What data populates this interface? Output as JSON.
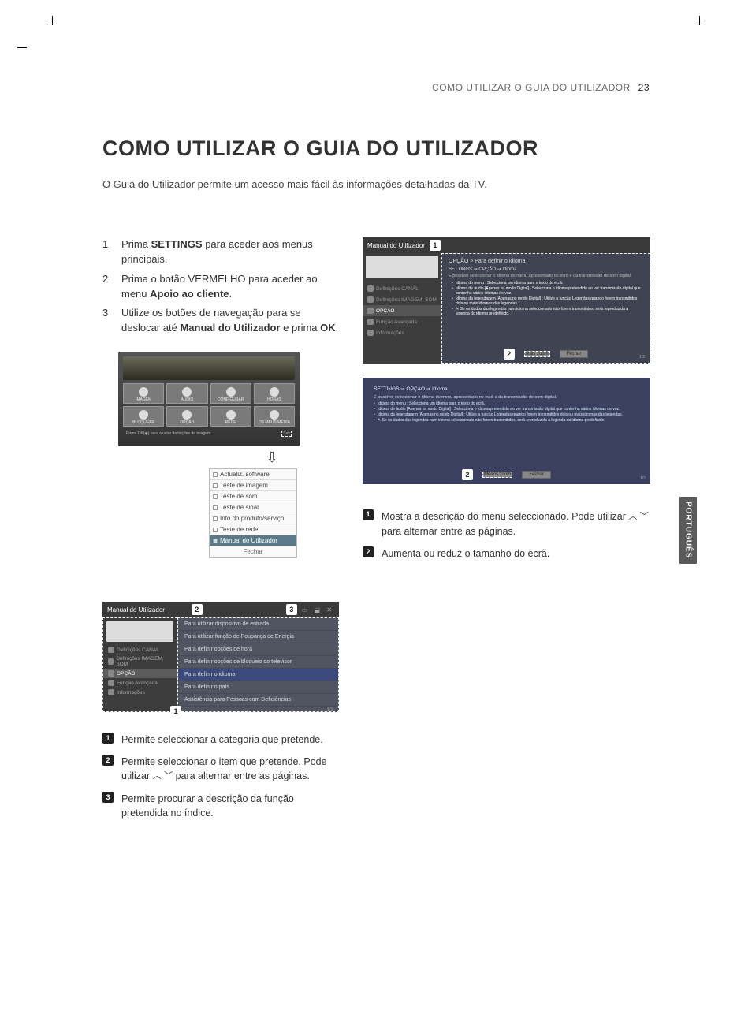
{
  "page": {
    "running_head": "COMO UTILIZAR O GUIA DO UTILIZADOR",
    "number": "23",
    "title": "COMO UTILIZAR O GUIA DO UTILIZADOR",
    "intro": "O Guia do Utilizador permite um acesso mais fácil às informações detalhadas da TV.",
    "side_tab": "PORTUGUÊS"
  },
  "steps": [
    {
      "n": "1",
      "pre": "Prima ",
      "bold": "SETTINGS",
      "post": " para aceder aos menus principais."
    },
    {
      "n": "2",
      "pre": "Prima o botão VERMELHO para aceder ao menu ",
      "bold": "Apoio ao cliente",
      "post": "."
    },
    {
      "n": "3",
      "pre": "Utilize os botões de navegação para se deslocar até ",
      "bold": "Manual do Utilizador",
      "post": " e prima ",
      "bold2": "OK",
      "post2": "."
    }
  ],
  "tv_menu": {
    "tiles": [
      "IMAGEM",
      "ÁUDIO",
      "CONFIGURAR",
      "HORAS",
      "BLOQUEAR",
      "OPÇÃO",
      "REDE",
      "OS MEUS MÉDIA"
    ],
    "footer_left": "Prima OK(◉) para ajustar definições de imagem.",
    "footer_right": "Sair"
  },
  "down_arrow": "⇩",
  "drop_list": {
    "items": [
      "Actualiz. software",
      "Teste de imagem",
      "Teste de som",
      "Teste de sinal",
      "Info do produto/serviço",
      "Teste de rede"
    ],
    "highlight": "Manual do Utilizador",
    "close": "Fechar"
  },
  "manual_wide": {
    "title": "Manual do Utilizador",
    "callout_a": "2",
    "callout_b": "3",
    "callout_c": "1",
    "side_cats": [
      "Definições CANAL",
      "Definições IMAGEM, SOM",
      "OPÇÃO",
      "Função Avançada",
      "Informações"
    ],
    "side_selected_index": 2,
    "rows": [
      "Para utilizar dispositivo de entrada",
      "Para utilizar função de Poupança de Energia",
      "Para definir opções de hora",
      "Para definir opções de bloqueio do televisor",
      "Para definir o idioma",
      "Para definir o país",
      "Assistência para Pessoas com Deficiências"
    ],
    "row_selected_index": 4,
    "footer": "1/2"
  },
  "left_callouts": [
    {
      "n": "1",
      "text": "Permite seleccionar a categoria que pretende."
    },
    {
      "n": "2",
      "text_pre": "Permite seleccionar o item que pretende. Pode utilizar ",
      "text_post": " para alternar entre as páginas."
    },
    {
      "n": "3",
      "text": "Permite procurar a descrição da função pretendida no índice."
    }
  ],
  "rs1": {
    "title": "Manual do Utilizador",
    "callout_a": "1",
    "callout_b": "2",
    "side_cats": [
      "Definições CANAL",
      "Definições IMAGEM, SOM",
      "OPÇÃO",
      "Função Avançada",
      "Informações"
    ],
    "side_selected_index": 2,
    "crumb_box": "OPÇÃO > Para definir o idioma",
    "sub": "SETTINGS ➙ OPÇÃO ➙ Idioma",
    "desc": "É possível seleccionar o idioma do menu apresentado no ecrã e da transmissão de som digital.",
    "bullets": [
      "Idioma do menu : Selecciona um idioma para o texto do ecrã.",
      "Idioma de áudio [Apenas no modo Digital] : Selecciona o idioma pretendido ao ver transmissão digital que contenha vários idiomas de voz.",
      "Idioma da legendagem [Apenas no modo Digital] : Utilize a função Legendas quando forem transmitidos dois ou mais idiomas das legendas.",
      "✎ Se os dados das legendas num idioma seleccionado não forem transmitidos, será reproduzida a legenda do idioma predefinido."
    ],
    "btn_zoom": "Mais zoom",
    "btn_close": "Fechar",
    "pager": "1/2"
  },
  "rs2": {
    "callout_b": "2",
    "crumb": "SETTINGS ➙ OPÇÃO ➙ Idioma",
    "desc": "É possível seleccionar o idioma do menu apresentado no ecrã e da transmissão de som digital.",
    "bullets": [
      "Idioma do menu : Selecciona um idioma para o texto do ecrã.",
      "Idioma de áudio [Apenas no modo Digital] : Selecciona o idioma pretendido ao ver transmissão digital que contenha vários idiomas de voz.",
      "Idioma da legendagem [Apenas no modo Digital] : Utilize a função Legendas quando forem transmitidos dois ou mais idiomas das legendas.",
      "✎ Se os dados das legendas num idioma seleccionado não forem transmitidos, será reproduzida a legenda do idioma predefinido."
    ],
    "btn_zoom": "Menos zoom",
    "btn_close": "Fechar",
    "pager": "1/2"
  },
  "right_callouts": [
    {
      "n": "1",
      "text_pre": "Mostra a descrição do menu seleccionado. Pode utilizar ",
      "text_post": " para alternar entre as páginas."
    },
    {
      "n": "2",
      "text": "Aumenta ou reduz o tamanho do ecrã."
    }
  ]
}
